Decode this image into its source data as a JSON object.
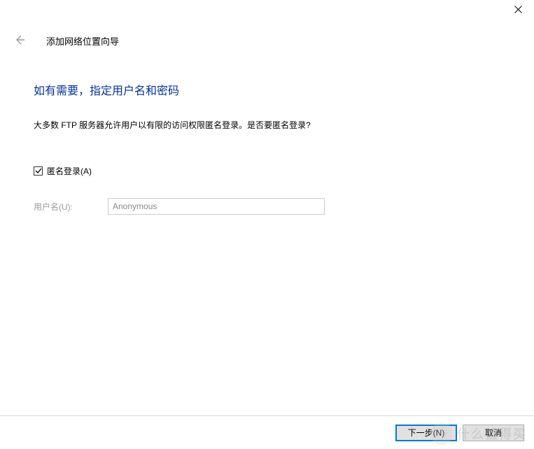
{
  "titlebar": {
    "close_icon": "close"
  },
  "header": {
    "back_icon": "back-arrow",
    "wizard_title": "添加网络位置向导"
  },
  "main": {
    "heading": "如有需要，指定用户名和密码",
    "description": "大多数 FTP 服务器允许用户以有限的访问权限匿名登录。是否要匿名登录?",
    "anonymous_checkbox": {
      "checked": true,
      "label": "匿名登录(A)"
    },
    "username_field": {
      "label": "用户名(U):",
      "value": "Anonymous"
    }
  },
  "buttons": {
    "next": "下一步(N)",
    "cancel": "取消"
  },
  "watermark": {
    "text": "什么值得买"
  }
}
